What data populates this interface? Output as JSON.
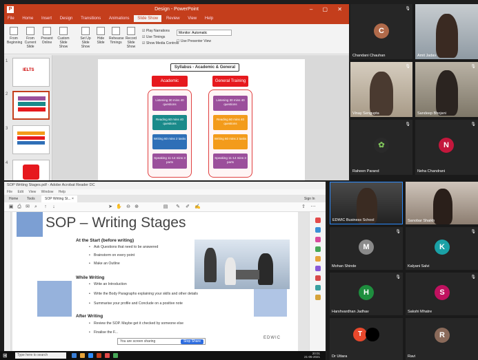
{
  "ppt": {
    "app_badge": "P",
    "title": "Design - PowerPoint",
    "window_controls": "–  ▢  ✕",
    "tabs": [
      "File",
      "Home",
      "Insert",
      "Design",
      "Transitions",
      "Animations",
      "Slide Show",
      "Review",
      "View",
      "Help"
    ],
    "active_tab": "Slide Show",
    "ribbon_buttons": [
      "From Beginning",
      "From Current Slide",
      "Present Online",
      "Custom Slide Show",
      "Set Up Slide Show",
      "Hide Slide",
      "Rehearse Timings",
      "Record Slide Show"
    ],
    "ribbon_checks": [
      "Play Narrations",
      "Use Timings",
      "Show Media Controls"
    ],
    "monitor_label": "Monitor: Automatic",
    "presenter_view": "Use Presenter View",
    "slide_numbers": [
      "1",
      "2",
      "3",
      "4"
    ],
    "slide": {
      "header": "Syllabus - Academic & General",
      "left_label": "Academic",
      "right_label": "General Training",
      "left_items": [
        "Listening\n30 mins\n40 questions",
        "Reading\n60 mins\n40 questions",
        "Writing\n60 mins\n2 tasks",
        "Speaking\n11-14 mins\n3 parts"
      ],
      "right_items": [
        "Listening\n30 mins\n40 questions",
        "Reading\n60 mins\n40 questions",
        "Writing\n60 mins\n2 tasks",
        "Speaking\n11-14 mins\n3 parts"
      ],
      "colors": {
        "red": "#e6191e",
        "purple": "#9b4f9b",
        "teal": "#1a8a8a",
        "orange": "#f39b1b",
        "blue": "#2f6fb7"
      }
    }
  },
  "zoom": {
    "participants": [
      {
        "name": "Chandani Chauhan",
        "initial": "C",
        "color": "#b06a4a",
        "video": false
      },
      {
        "name": "Amit Jadav",
        "initial": "",
        "color": "",
        "video": true
      },
      {
        "name": "Vinay Sengupta",
        "initial": "",
        "color": "",
        "video": true
      },
      {
        "name": "Sandeep Bhojani",
        "initial": "",
        "color": "",
        "video": true
      },
      {
        "name": "Raheen Parand",
        "initial": "",
        "color": "#2a2a2a",
        "video": false
      },
      {
        "name": "Neha Chandrani",
        "initial": "N",
        "color": "#c4173c",
        "video": false
      },
      {
        "name": "EDWIC Business School",
        "initial": "",
        "color": "",
        "video": true
      },
      {
        "name": "Sanobar Shaikh",
        "initial": "",
        "color": "",
        "video": true
      },
      {
        "name": "Mohan Shinde",
        "initial": "M",
        "color": "#8a8a8a",
        "video": false
      },
      {
        "name": "Kalyani Salvi",
        "initial": "K",
        "color": "#1aa1a6",
        "video": false
      },
      {
        "name": "Harshvardhan Jadhav",
        "initial": "H",
        "color": "#1e8e3e",
        "video": false
      },
      {
        "name": "Sakshi Mhatre",
        "initial": "S",
        "color": "#c0115f",
        "video": false
      },
      {
        "name": "Dr Uttara",
        "initial": "T",
        "color": "#e8482c",
        "video": false
      },
      {
        "name": "Ravi",
        "initial": "R",
        "color": "#8a6a5a",
        "video": false
      }
    ],
    "mic_icon": "🎙"
  },
  "pdf": {
    "window_title": "SOP Writing Stages.pdf - Adobe Acrobat Reader DC",
    "menu": [
      "File",
      "Edit",
      "View",
      "Window",
      "Help"
    ],
    "tabs": [
      "Home",
      "Tools",
      "SOP Writing St... ×"
    ],
    "sign_in": "Sign In",
    "page_title": "SOP – Writing Stages",
    "sections": [
      {
        "heading": "At the Start (before writing)",
        "bullets": [
          "Ask Questions that need to be answered",
          "Brainstorm on every point",
          "Make an Outline"
        ]
      },
      {
        "heading": "While Writing",
        "bullets": [
          "Write an Introduction",
          "Write the Body Paragraphs explaining your skills and other details",
          "Summarise your profile and Conclude on a positive note"
        ]
      },
      {
        "heading": "After Writing",
        "bullets": [
          "Review the SOP. Maybe get it checked by someone else",
          "Finalise the F..."
        ]
      }
    ],
    "watermark": "EDWIC"
  },
  "share_bar": {
    "text": "You are screen sharing",
    "stop": "Stop Share"
  },
  "taskbar": {
    "search_placeholder": "Type here to search",
    "time": "20:01",
    "date": "21-05-2021"
  }
}
